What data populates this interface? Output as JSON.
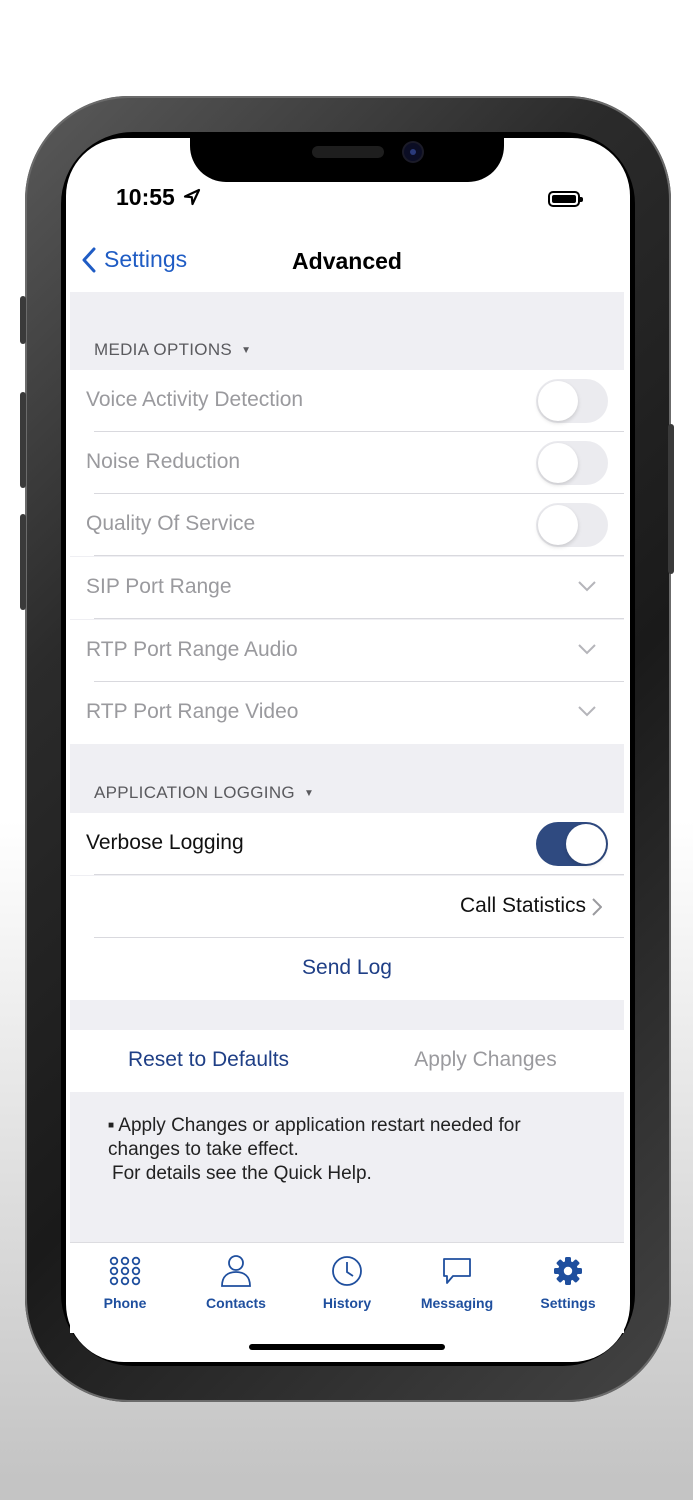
{
  "status": {
    "time": "10:55"
  },
  "nav": {
    "back_label": "Settings",
    "title": "Advanced"
  },
  "media": {
    "header": "MEDIA OPTIONS",
    "items": [
      {
        "label": "Voice Activity Detection",
        "control": "toggle",
        "on": false
      },
      {
        "label": "Noise Reduction",
        "control": "toggle",
        "on": false
      },
      {
        "label": "Quality Of Service",
        "control": "toggle",
        "on": false
      },
      {
        "label": "SIP Port Range",
        "control": "chevron"
      },
      {
        "label": "RTP Port Range Audio",
        "control": "chevron"
      },
      {
        "label": "RTP Port Range Video",
        "control": "chevron"
      }
    ]
  },
  "logging": {
    "header": "APPLICATION LOGGING",
    "verbose_label": "Verbose Logging",
    "verbose_on": true,
    "call_stats_label": "Call Statistics",
    "send_log_label": "Send Log"
  },
  "actions": {
    "reset_label": "Reset to Defaults",
    "apply_label": "Apply Changes"
  },
  "note": {
    "line1": "Apply Changes or application restart needed for",
    "line2": "changes to take effect.",
    "line3": "For details see the Quick Help."
  },
  "tabs": [
    {
      "label": "Phone",
      "icon": "dialpad-icon"
    },
    {
      "label": "Contacts",
      "icon": "person-icon"
    },
    {
      "label": "History",
      "icon": "clock-icon"
    },
    {
      "label": "Messaging",
      "icon": "chat-bubble-icon"
    },
    {
      "label": "Settings",
      "icon": "gear-icon"
    }
  ],
  "colors": {
    "accent": "#1f5cc4",
    "toggle_on": "#2f4a80",
    "tab_label": "#1f4f9e",
    "group_bg": "#efeff3"
  }
}
